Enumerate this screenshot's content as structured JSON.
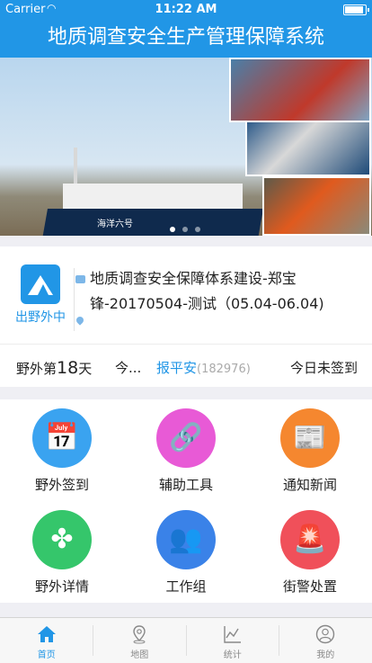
{
  "status_bar": {
    "carrier": "Carrier",
    "time": "11:22 AM",
    "battery_level": 1.0
  },
  "header": {
    "title": "地质调查安全生产管理保障系统"
  },
  "banner": {
    "ship_name": "海洋六号",
    "slides": 3,
    "active_slide": 1
  },
  "field_card": {
    "status_label": "出野外中",
    "project": "地质调查安全保障体系建设-郑宝锋-20170504-测试（05.04-06.04)",
    "days_prefix": "野外第",
    "days_value": "18",
    "days_suffix": "天",
    "ellipsis": "今...",
    "report_link": "报平安",
    "report_count": "(182976)",
    "sign_status": "今日未签到"
  },
  "menu": [
    {
      "label": "野外签到",
      "color": "#3aa3f0",
      "icon": "calendar-check-icon"
    },
    {
      "label": "辅助工具",
      "color": "#e85ad6",
      "icon": "link-icon"
    },
    {
      "label": "通知新闻",
      "color": "#f5872f",
      "icon": "newspaper-icon"
    },
    {
      "label": "野外详情",
      "color": "#35c66b",
      "icon": "clover-icon"
    },
    {
      "label": "工作组",
      "color": "#3a82e8",
      "icon": "group-icon"
    },
    {
      "label": "街警处置",
      "color": "#f0505a",
      "icon": "alarm-light-icon"
    }
  ],
  "tabs": [
    {
      "label": "首页",
      "icon": "home-icon",
      "active": true
    },
    {
      "label": "地图",
      "icon": "map-pin-icon",
      "active": false
    },
    {
      "label": "统计",
      "icon": "chart-icon",
      "active": false
    },
    {
      "label": "我的",
      "icon": "user-icon",
      "active": false
    }
  ],
  "colors": {
    "primary": "#2196e6",
    "muted": "#888888"
  }
}
